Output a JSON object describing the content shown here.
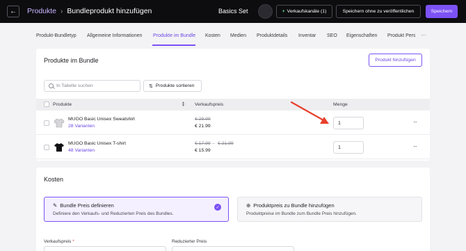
{
  "header": {
    "breadcrumb_parent": "Produkte",
    "breadcrumb_separator": "›",
    "page_title": "Bundleprodukt hinzufügen",
    "set_name": "Basics Set",
    "sales_channels_label": "Verkaufskanäle (1)",
    "save_unpublished_label": "Speichern ohne zu veröffentlichen",
    "save_label": "Speichern"
  },
  "tabs": [
    {
      "label": "Produkt-Bundletyp"
    },
    {
      "label": "Allgemeine Informationen"
    },
    {
      "label": "Produkte im Bundle"
    },
    {
      "label": "Kosten"
    },
    {
      "label": "Medien"
    },
    {
      "label": "Produktdetails"
    },
    {
      "label": "Inventar"
    },
    {
      "label": "SEO"
    },
    {
      "label": "Eigenschaften"
    },
    {
      "label": "Produkt Pers"
    }
  ],
  "active_tab": "Produkte im Bundle",
  "bundle_products": {
    "title": "Produkte im Bundle",
    "add_button": "Produkt hinzufügen",
    "search_placeholder": "In Tabelle suchen",
    "sort_button": "Produkte sortieren",
    "columns": {
      "product": "Produkte",
      "price": "Verkaufspreis",
      "quantity": "Menge"
    },
    "rows": [
      {
        "name": "MUGO Basic Unisex Sweatshirt",
        "variants": "28 Varianten",
        "price_old": "€ 29.99",
        "price_new": "€ 21.99",
        "quantity": "1"
      },
      {
        "name": "MUGO Basic Unisex T-shirt",
        "variants": "48 Varianten",
        "price_old": "€ 17.99",
        "price_dash": "–",
        "price_old_2": "€ 21.99",
        "price_new": "€ 15.99",
        "quantity": "1"
      }
    ]
  },
  "costs": {
    "title": "Kosten",
    "option_1": {
      "title": "Bundle Preis definieren",
      "description": "Definiere den Verkaufs- und Reduzierten Preis des Bundles."
    },
    "option_2": {
      "title": "Produktpreis zu Bundle hinzufügen",
      "description": "Produktpreise im Bundle zum Bundle Preis hinzufügen."
    },
    "sale_price_label": "Verkaufspreis",
    "required_marker": "*",
    "reduced_price_label": "Reduzierter Preis"
  },
  "colors": {
    "accent": "#7c52f5",
    "annotation_arrow": "#e8402c",
    "topbar": "#0d0d10"
  },
  "icons": {
    "back": "arrow-left-icon",
    "search": "search-icon",
    "sort": "sort-icon",
    "more": "ellipsis-icon",
    "pencil": "pencil-icon",
    "plus_circle": "plus-circle-icon",
    "check": "check-icon"
  }
}
